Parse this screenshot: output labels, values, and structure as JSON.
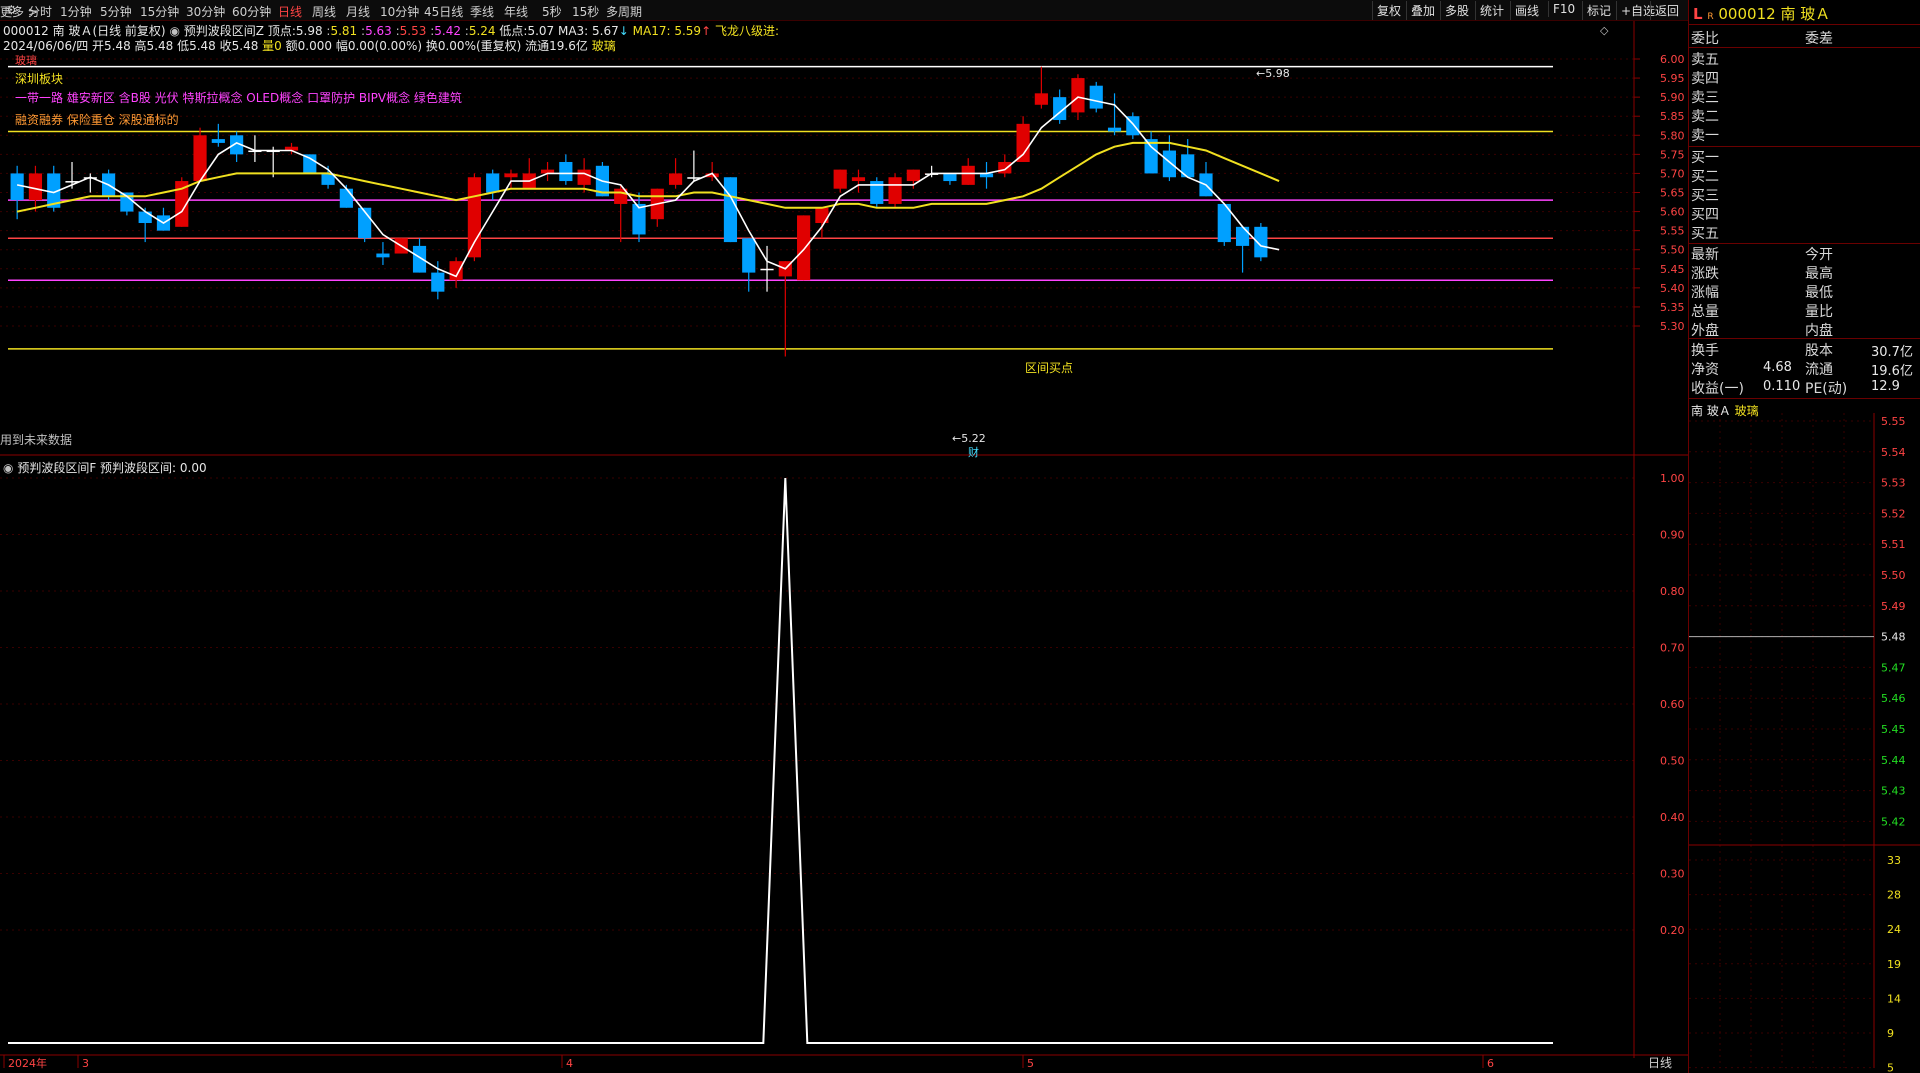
{
  "toolbar": {
    "periods": [
      "分时",
      "1分钟",
      "5分钟",
      "15分钟",
      "30分钟",
      "60分钟",
      "日线",
      "周线",
      "月线",
      "10分钟",
      "45日线",
      "季线",
      "年线",
      "5秒",
      "15秒",
      "多周期",
      "更多 >"
    ],
    "active_period": "日线",
    "right_buttons": [
      "复权",
      "叠加",
      "多股",
      "统计",
      "画线",
      "F10",
      "标记",
      "+自选",
      "返回"
    ]
  },
  "info_line1": {
    "stock": "000012 南 玻Ａ(日线 前复权)",
    "indicator": "预判波段区间Z",
    "top_label": "顶点:",
    "top_vals": [
      "5.98",
      "5.81",
      "5.63",
      "5.53",
      "5.42"
    ],
    "current": "5.24",
    "low_label": "低点:",
    "low_val": "5.07",
    "ma3": "MA3: 5.67",
    "ma17": "MA17: 5.59",
    "signal": "飞龙八级进:"
  },
  "info_line2": {
    "text": "2024/06/06/四 开5.48 高5.48 低5.48 收5.48",
    "vol": "量0",
    "amt": "额0.000",
    "rest": "幅0.00(0.00%) 换0.00%(重复权) 流通19.6亿",
    "industry": "玻璃"
  },
  "overlay": {
    "tag": "玻璃",
    "board": "深圳板块",
    "concepts": "一带一路 雄安新区 含B股 光伏 特斯拉概念 OLED概念 口罩防护 BIPV概念 绿色建筑",
    "margin": "融资融券 保险重仓 深股通标的",
    "buy_zone": "区间买点",
    "future_data": "用到未来数据",
    "high_marker": "5.98",
    "low_marker": "5.22",
    "cai": "财"
  },
  "price_axis": [
    "6.00",
    "5.95",
    "5.90",
    "5.85",
    "5.80",
    "5.75",
    "5.70",
    "5.65",
    "5.60",
    "5.55",
    "5.50",
    "5.45",
    "5.40",
    "5.35",
    "5.30"
  ],
  "sub_indicator": {
    "title": "预判波段区间F",
    "label": "预判波段区间: 0.00",
    "axis": [
      "1.00",
      "0.90",
      "0.80",
      "0.70",
      "0.60",
      "0.50",
      "0.40",
      "0.30",
      "0.20"
    ]
  },
  "date_axis": {
    "labels": [
      "2024年",
      "3",
      "4",
      "5",
      "6"
    ],
    "period": "日线"
  },
  "right_panel": {
    "code": "000012",
    "name": "南 玻Ａ",
    "wei_bi": "委比",
    "wei_cha": "委差",
    "sell": [
      "卖五",
      "卖四",
      "卖三",
      "卖二",
      "卖一"
    ],
    "buy": [
      "买一",
      "买二",
      "买三",
      "买四",
      "买五"
    ],
    "stats_left": [
      "最新",
      "涨跌",
      "涨幅",
      "总量",
      "外盘"
    ],
    "stats_right": [
      "今开",
      "最高",
      "最低",
      "量比",
      "内盘"
    ],
    "fund_labels": [
      "换手",
      "净资",
      "收益(一)"
    ],
    "fund_vals": [
      "",
      "4.68",
      "0.110"
    ],
    "fund_labels2": [
      "股本",
      "流通",
      "PE(动)"
    ],
    "fund_vals2": [
      "30.7亿",
      "19.6亿",
      "12.9"
    ],
    "mini_title": "南 玻Ａ",
    "mini_industry": "玻璃",
    "mini_price_axis": [
      "5.55",
      "5.54",
      "5.53",
      "5.52",
      "5.51",
      "5.50",
      "5.49",
      "5.48",
      "5.47",
      "5.46",
      "5.45",
      "5.44",
      "5.43",
      "5.42"
    ],
    "mini_vol_axis": [
      "33",
      "28",
      "24",
      "19",
      "14",
      "9",
      "5"
    ]
  },
  "chart_data": {
    "type": "candlestick",
    "candles": [
      {
        "o": 5.7,
        "h": 5.72,
        "l": 5.58,
        "c": 5.63
      },
      {
        "o": 5.63,
        "h": 5.72,
        "l": 5.6,
        "c": 5.7
      },
      {
        "o": 5.7,
        "h": 5.72,
        "l": 5.6,
        "c": 5.61
      },
      {
        "o": 5.68,
        "h": 5.73,
        "l": 5.66,
        "c": 5.68
      },
      {
        "o": 5.69,
        "h": 5.7,
        "l": 5.65,
        "c": 5.69
      },
      {
        "o": 5.7,
        "h": 5.71,
        "l": 5.63,
        "c": 5.64
      },
      {
        "o": 5.65,
        "h": 5.65,
        "l": 5.59,
        "c": 5.6
      },
      {
        "o": 5.6,
        "h": 5.61,
        "l": 5.52,
        "c": 5.57
      },
      {
        "o": 5.59,
        "h": 5.61,
        "l": 5.55,
        "c": 5.55
      },
      {
        "o": 5.56,
        "h": 5.69,
        "l": 5.56,
        "c": 5.68
      },
      {
        "o": 5.68,
        "h": 5.82,
        "l": 5.68,
        "c": 5.8
      },
      {
        "o": 5.79,
        "h": 5.83,
        "l": 5.77,
        "c": 5.78
      },
      {
        "o": 5.8,
        "h": 5.81,
        "l": 5.73,
        "c": 5.75
      },
      {
        "o": 5.76,
        "h": 5.8,
        "l": 5.73,
        "c": 5.76
      },
      {
        "o": 5.76,
        "h": 5.77,
        "l": 5.69,
        "c": 5.76
      },
      {
        "o": 5.76,
        "h": 5.78,
        "l": 5.75,
        "c": 5.77
      },
      {
        "o": 5.75,
        "h": 5.75,
        "l": 5.7,
        "c": 5.7
      },
      {
        "o": 5.7,
        "h": 5.72,
        "l": 5.66,
        "c": 5.67
      },
      {
        "o": 5.66,
        "h": 5.67,
        "l": 5.61,
        "c": 5.61
      },
      {
        "o": 5.61,
        "h": 5.61,
        "l": 5.52,
        "c": 5.53
      },
      {
        "o": 5.49,
        "h": 5.52,
        "l": 5.46,
        "c": 5.48
      },
      {
        "o": 5.49,
        "h": 5.53,
        "l": 5.49,
        "c": 5.53
      },
      {
        "o": 5.51,
        "h": 5.53,
        "l": 5.44,
        "c": 5.44
      },
      {
        "o": 5.44,
        "h": 5.47,
        "l": 5.37,
        "c": 5.39
      },
      {
        "o": 5.42,
        "h": 5.48,
        "l": 5.4,
        "c": 5.47
      },
      {
        "o": 5.48,
        "h": 5.7,
        "l": 5.47,
        "c": 5.69
      },
      {
        "o": 5.7,
        "h": 5.71,
        "l": 5.63,
        "c": 5.65
      },
      {
        "o": 5.69,
        "h": 5.71,
        "l": 5.66,
        "c": 5.7
      },
      {
        "o": 5.66,
        "h": 5.74,
        "l": 5.66,
        "c": 5.7
      },
      {
        "o": 5.7,
        "h": 5.73,
        "l": 5.68,
        "c": 5.71
      },
      {
        "o": 5.73,
        "h": 5.75,
        "l": 5.67,
        "c": 5.68
      },
      {
        "o": 5.67,
        "h": 5.74,
        "l": 5.65,
        "c": 5.71
      },
      {
        "o": 5.72,
        "h": 5.73,
        "l": 5.64,
        "c": 5.64
      },
      {
        "o": 5.62,
        "h": 5.67,
        "l": 5.52,
        "c": 5.66
      },
      {
        "o": 5.62,
        "h": 5.65,
        "l": 5.52,
        "c": 5.54
      },
      {
        "o": 5.58,
        "h": 5.66,
        "l": 5.56,
        "c": 5.66
      },
      {
        "o": 5.67,
        "h": 5.74,
        "l": 5.66,
        "c": 5.7
      },
      {
        "o": 5.69,
        "h": 5.76,
        "l": 5.68,
        "c": 5.69
      },
      {
        "o": 5.69,
        "h": 5.73,
        "l": 5.68,
        "c": 5.7
      },
      {
        "o": 5.69,
        "h": 5.69,
        "l": 5.52,
        "c": 5.52
      },
      {
        "o": 5.53,
        "h": 5.53,
        "l": 5.39,
        "c": 5.44
      },
      {
        "o": 5.45,
        "h": 5.51,
        "l": 5.39,
        "c": 5.45
      },
      {
        "o": 5.43,
        "h": 5.47,
        "l": 5.22,
        "c": 5.47
      },
      {
        "o": 5.42,
        "h": 5.59,
        "l": 5.42,
        "c": 5.59
      },
      {
        "o": 5.57,
        "h": 5.61,
        "l": 5.53,
        "c": 5.61
      },
      {
        "o": 5.66,
        "h": 5.71,
        "l": 5.65,
        "c": 5.71
      },
      {
        "o": 5.68,
        "h": 5.71,
        "l": 5.65,
        "c": 5.69
      },
      {
        "o": 5.68,
        "h": 5.69,
        "l": 5.61,
        "c": 5.62
      },
      {
        "o": 5.62,
        "h": 5.7,
        "l": 5.61,
        "c": 5.69
      },
      {
        "o": 5.68,
        "h": 5.71,
        "l": 5.66,
        "c": 5.71
      },
      {
        "o": 5.7,
        "h": 5.72,
        "l": 5.69,
        "c": 5.7
      },
      {
        "o": 5.7,
        "h": 5.7,
        "l": 5.67,
        "c": 5.68
      },
      {
        "o": 5.67,
        "h": 5.74,
        "l": 5.67,
        "c": 5.72
      },
      {
        "o": 5.7,
        "h": 5.73,
        "l": 5.66,
        "c": 5.69
      },
      {
        "o": 5.7,
        "h": 5.75,
        "l": 5.69,
        "c": 5.73
      },
      {
        "o": 5.73,
        "h": 5.85,
        "l": 5.73,
        "c": 5.83
      },
      {
        "o": 5.88,
        "h": 5.98,
        "l": 5.87,
        "c": 5.91
      },
      {
        "o": 5.9,
        "h": 5.92,
        "l": 5.83,
        "c": 5.84
      },
      {
        "o": 5.86,
        "h": 5.96,
        "l": 5.84,
        "c": 5.95
      },
      {
        "o": 5.93,
        "h": 5.94,
        "l": 5.86,
        "c": 5.87
      },
      {
        "o": 5.82,
        "h": 5.91,
        "l": 5.8,
        "c": 5.81
      },
      {
        "o": 5.85,
        "h": 5.86,
        "l": 5.79,
        "c": 5.8
      },
      {
        "o": 5.79,
        "h": 5.81,
        "l": 5.7,
        "c": 5.7
      },
      {
        "o": 5.76,
        "h": 5.8,
        "l": 5.68,
        "c": 5.69
      },
      {
        "o": 5.75,
        "h": 5.79,
        "l": 5.69,
        "c": 5.69
      },
      {
        "o": 5.7,
        "h": 5.73,
        "l": 5.64,
        "c": 5.64
      },
      {
        "o": 5.62,
        "h": 5.62,
        "l": 5.51,
        "c": 5.52
      },
      {
        "o": 5.56,
        "h": 5.56,
        "l": 5.44,
        "c": 5.51
      },
      {
        "o": 5.56,
        "h": 5.57,
        "l": 5.47,
        "c": 5.48
      }
    ],
    "ma3": [
      5.67,
      5.66,
      5.65,
      5.67,
      5.69,
      5.67,
      5.64,
      5.6,
      5.57,
      5.6,
      5.68,
      5.75,
      5.78,
      5.76,
      5.76,
      5.76,
      5.74,
      5.71,
      5.66,
      5.6,
      5.54,
      5.51,
      5.48,
      5.45,
      5.43,
      5.52,
      5.6,
      5.68,
      5.68,
      5.7,
      5.7,
      5.7,
      5.68,
      5.67,
      5.61,
      5.62,
      5.63,
      5.68,
      5.7,
      5.64,
      5.55,
      5.47,
      5.45,
      5.5,
      5.56,
      5.64,
      5.67,
      5.67,
      5.67,
      5.67,
      5.7,
      5.7,
      5.7,
      5.7,
      5.71,
      5.75,
      5.82,
      5.86,
      5.9,
      5.89,
      5.88,
      5.83,
      5.77,
      5.73,
      5.69,
      5.67,
      5.62,
      5.56,
      5.51,
      5.5
    ],
    "ma17": [
      5.6,
      5.61,
      5.62,
      5.63,
      5.64,
      5.64,
      5.64,
      5.64,
      5.65,
      5.66,
      5.68,
      5.69,
      5.7,
      5.7,
      5.7,
      5.7,
      5.7,
      5.7,
      5.69,
      5.68,
      5.67,
      5.66,
      5.65,
      5.64,
      5.63,
      5.64,
      5.65,
      5.66,
      5.66,
      5.66,
      5.66,
      5.66,
      5.65,
      5.65,
      5.64,
      5.64,
      5.64,
      5.65,
      5.65,
      5.64,
      5.63,
      5.62,
      5.61,
      5.61,
      5.61,
      5.62,
      5.62,
      5.61,
      5.61,
      5.61,
      5.62,
      5.62,
      5.62,
      5.62,
      5.63,
      5.64,
      5.66,
      5.69,
      5.72,
      5.75,
      5.77,
      5.78,
      5.78,
      5.78,
      5.77,
      5.76,
      5.74,
      5.72,
      5.7,
      5.68
    ],
    "levels": [
      {
        "value": 5.98,
        "color": "#ffffff"
      },
      {
        "value": 5.81,
        "color": "#f0e020"
      },
      {
        "value": 5.63,
        "color": "#ff44ff"
      },
      {
        "value": 5.53,
        "color": "#ff4444"
      },
      {
        "value": 5.42,
        "color": "#ff44ff"
      },
      {
        "value": 5.24,
        "color": "#f0e020"
      }
    ],
    "price_range": [
      5.22,
      6.02
    ],
    "sub_series": {
      "type": "line",
      "ylim": [
        0,
        1.05
      ],
      "spike_index": 42,
      "spike_value": 1.0,
      "baseline": 0.0
    },
    "colors": {
      "up": "#e00000",
      "down": "#00a0ff",
      "flat": "#ffffff",
      "ma3": "#ffffff",
      "ma17": "#f0e020",
      "bg": "#000000"
    }
  }
}
